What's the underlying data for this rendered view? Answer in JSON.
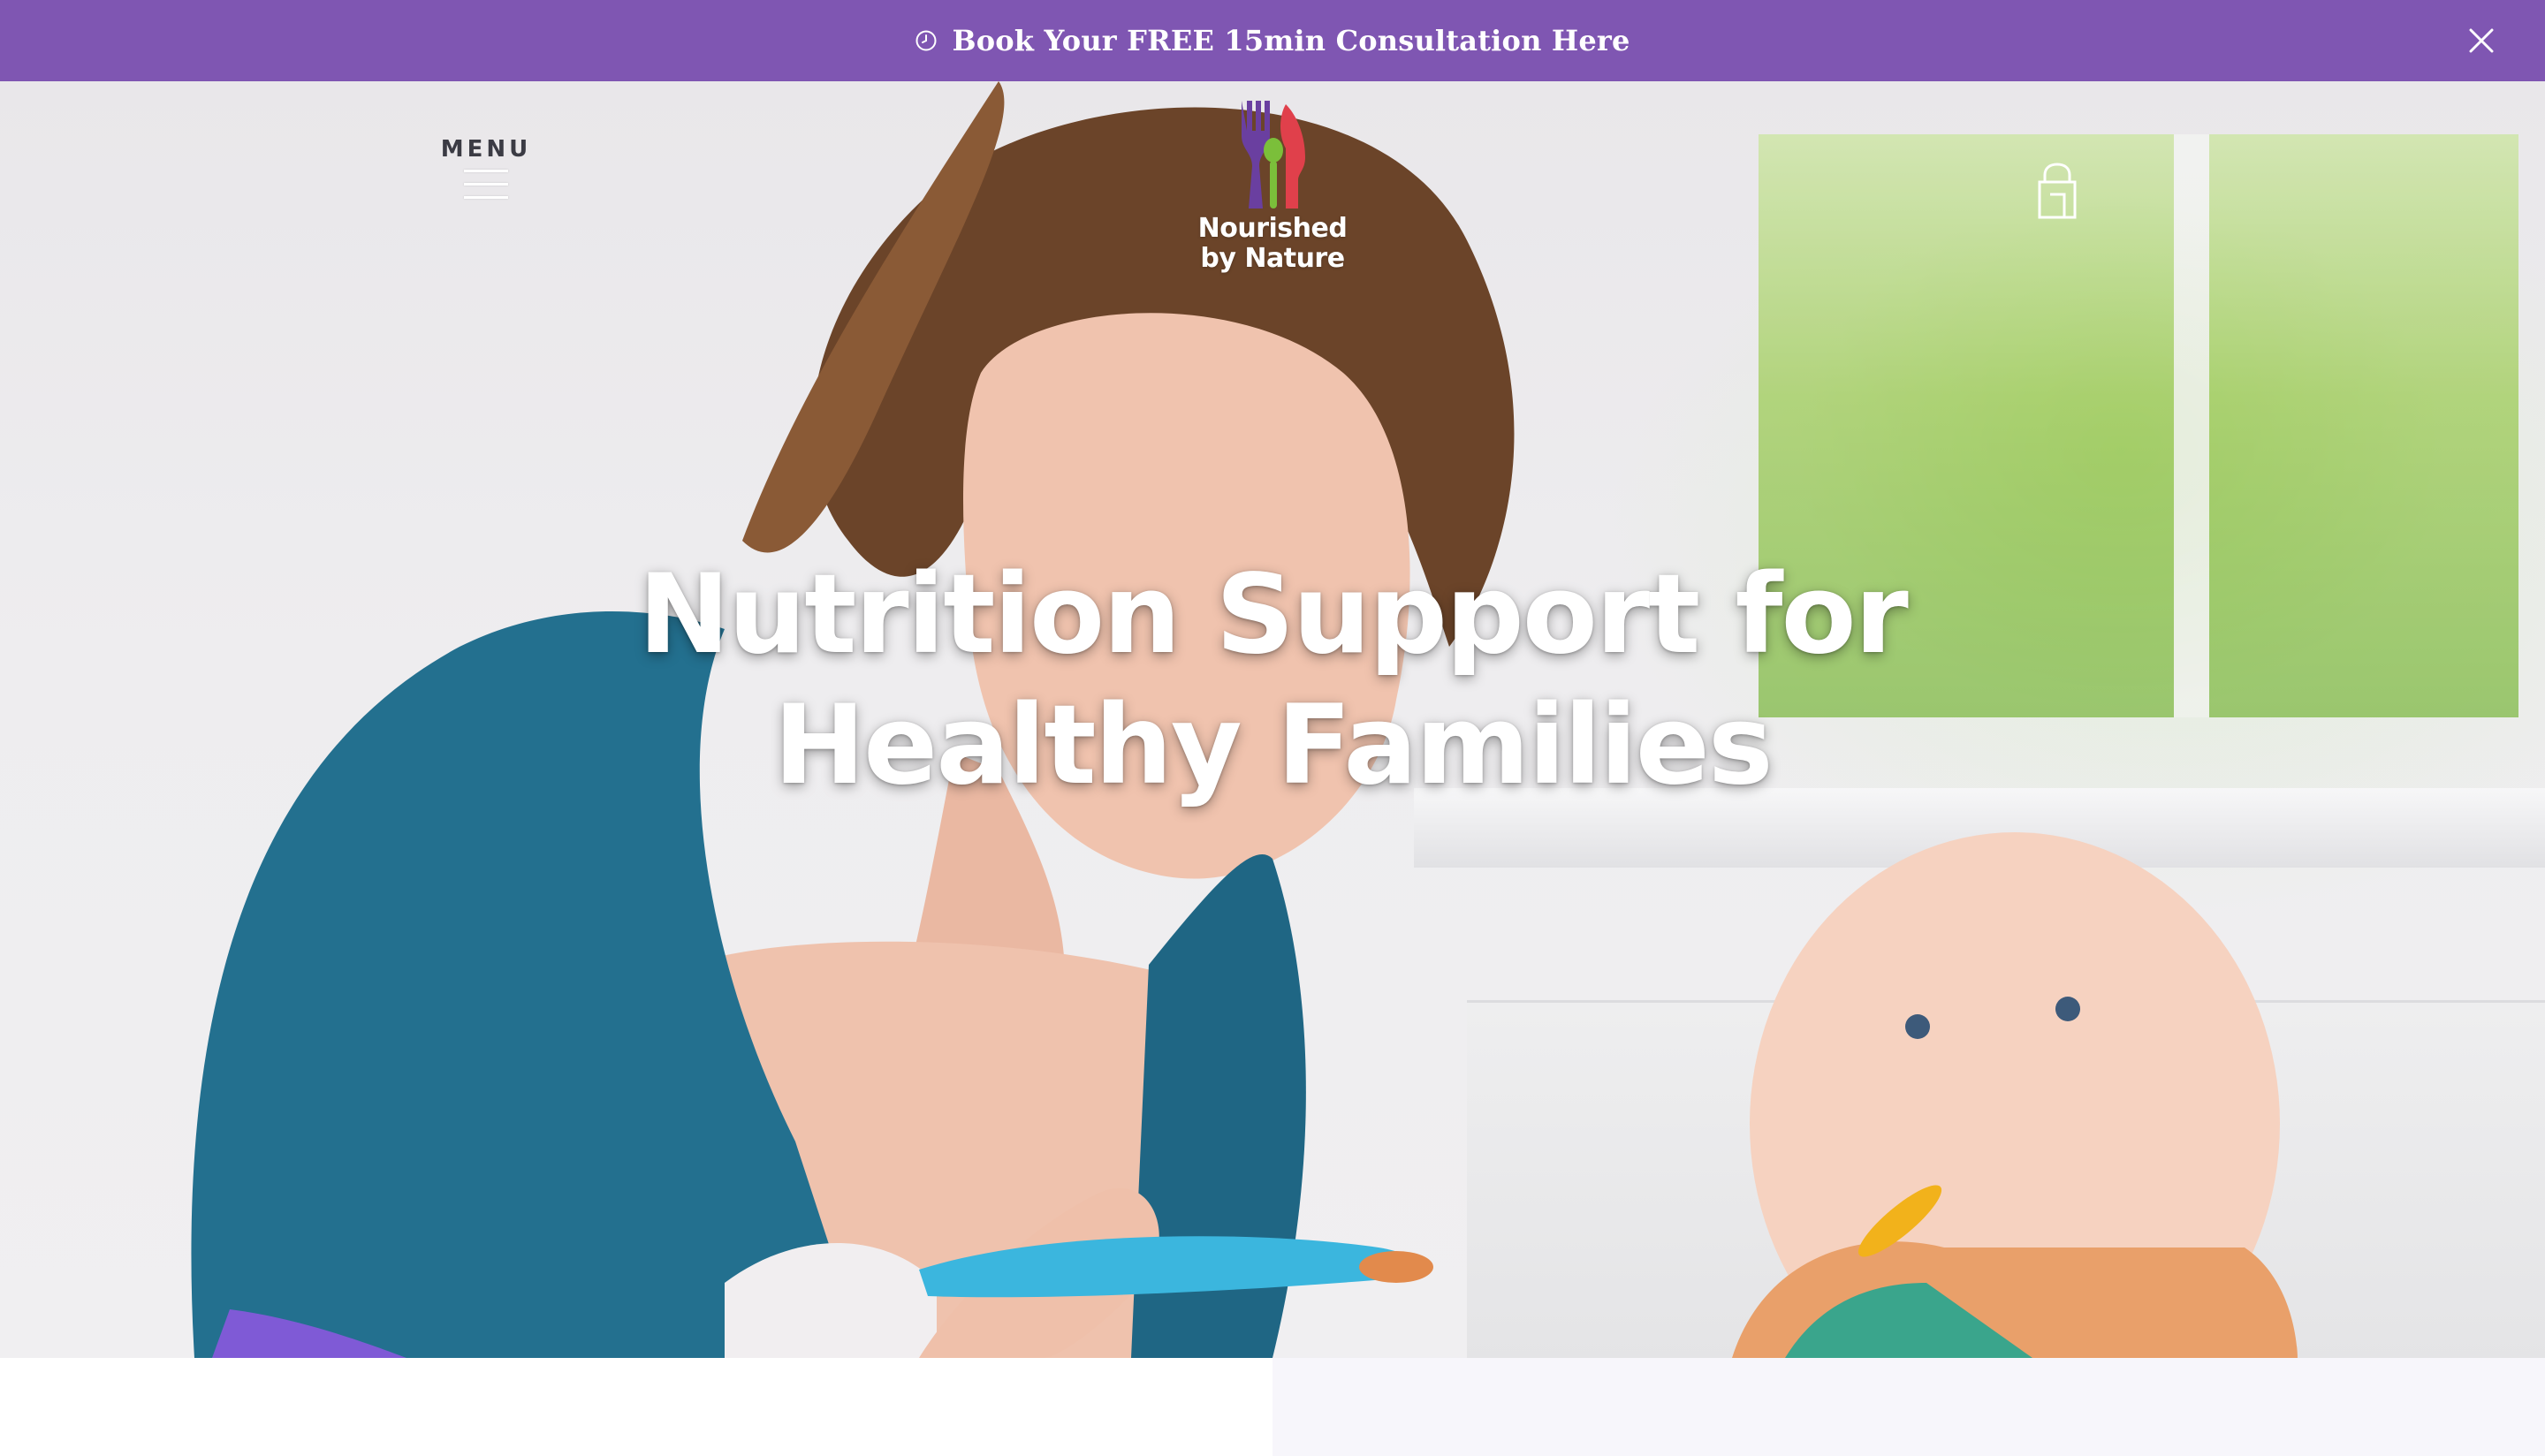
{
  "announcement": {
    "icon": "clock-icon",
    "text": "Book Your FREE 15min Consultation Here",
    "close_icon": "close-icon",
    "background": "#7f56b2",
    "text_color": "#ffffff"
  },
  "header": {
    "menu_label": "MENU",
    "menu_icon": "hamburger-icon",
    "logo": {
      "line1": "Nourished",
      "line2": "by Nature",
      "colors": [
        "#6a3fa0",
        "#e0404b",
        "#7bbf3a"
      ]
    },
    "cart_icon": "shopping-bag-icon"
  },
  "hero": {
    "heading_line1": "Nutrition Support for",
    "heading_line2": "Healthy Families"
  }
}
